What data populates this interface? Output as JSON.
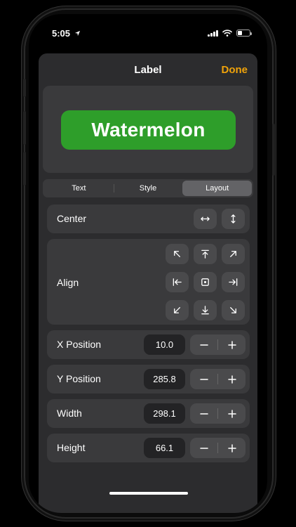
{
  "status_bar": {
    "time": "5:05"
  },
  "sheet": {
    "title": "Label",
    "done_label": "Done"
  },
  "preview": {
    "label_text": "Watermelon",
    "label_color": "#2e9e2a"
  },
  "tabs": [
    {
      "label": "Text",
      "active": false
    },
    {
      "label": "Style",
      "active": false
    },
    {
      "label": "Layout",
      "active": true
    }
  ],
  "layout": {
    "center": {
      "label": "Center",
      "buttons": [
        "center-horizontal-icon",
        "center-vertical-icon"
      ]
    },
    "align": {
      "label": "Align",
      "buttons": [
        "arrow-up-left-icon",
        "align-top-icon",
        "arrow-up-right-icon",
        "align-left-icon",
        "align-center-icon",
        "align-right-icon",
        "arrow-down-left-icon",
        "align-bottom-icon",
        "arrow-down-right-icon"
      ]
    },
    "fields": [
      {
        "label": "X Position",
        "value": "10.0"
      },
      {
        "label": "Y Position",
        "value": "285.8"
      },
      {
        "label": "Width",
        "value": "298.1"
      },
      {
        "label": "Height",
        "value": "66.1"
      }
    ]
  },
  "colors": {
    "accent": "#f0a30a",
    "sheet_bg": "#2c2c2e",
    "row_bg": "#3a3a3c"
  }
}
